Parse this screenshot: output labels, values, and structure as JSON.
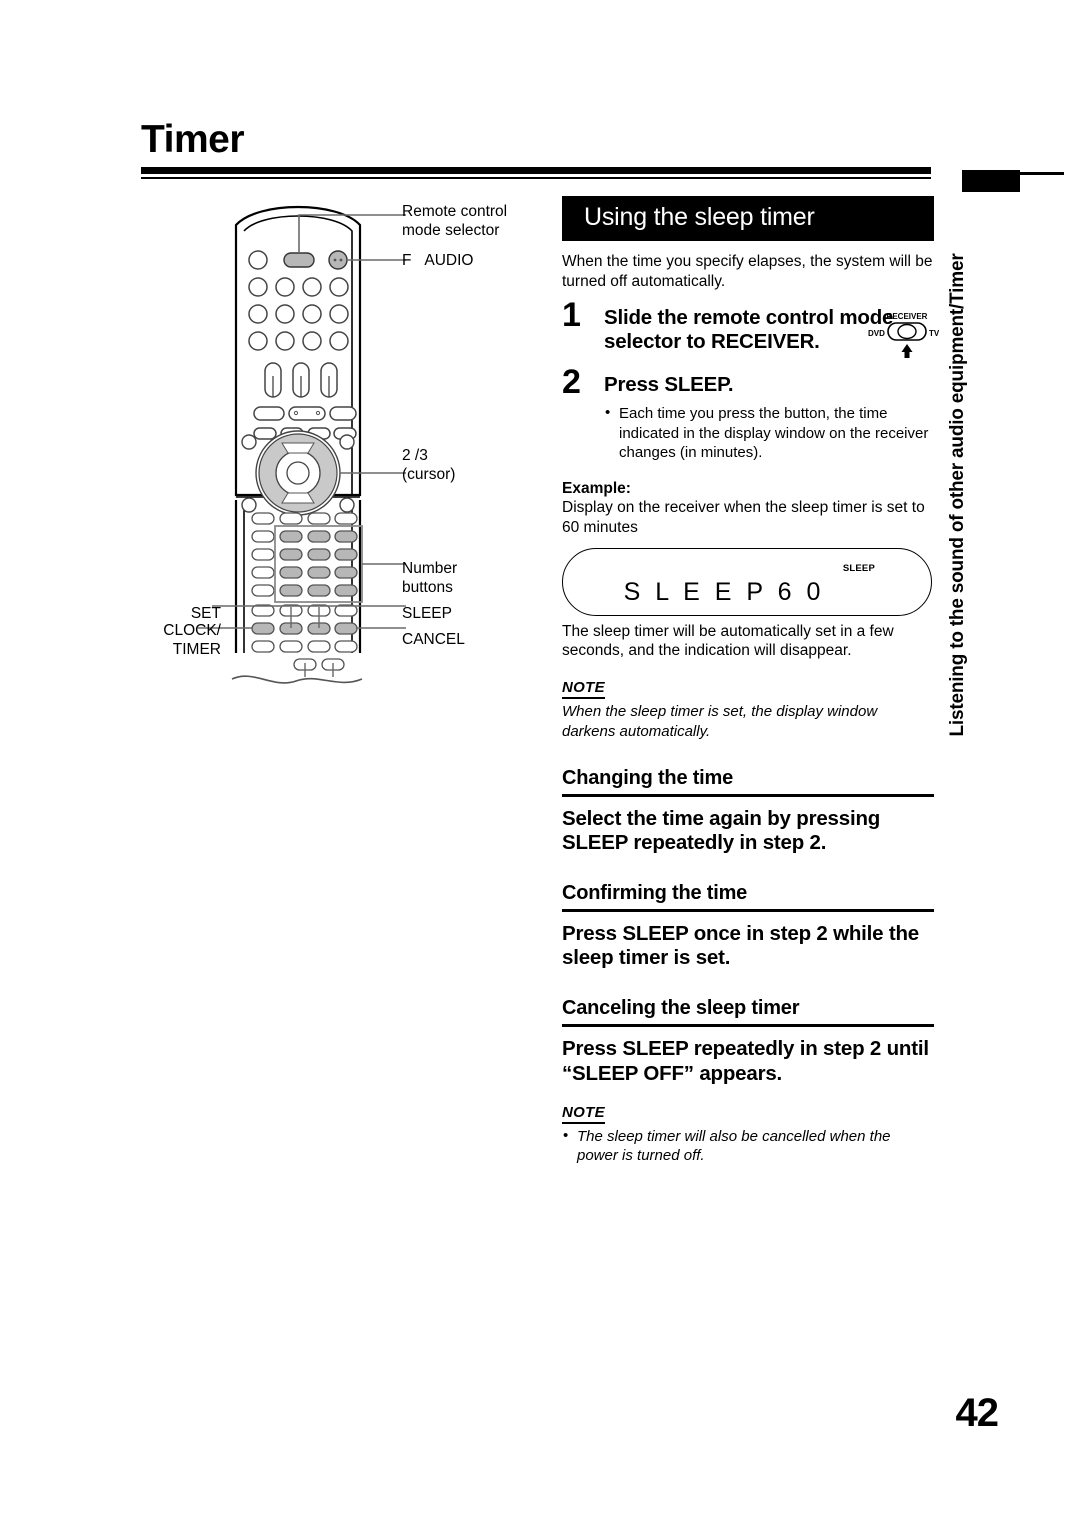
{
  "page": {
    "title": "Timer",
    "number": "42",
    "running_head_vertical": "Listening to the sound of other audio equipment/Timer"
  },
  "remote_diagram": {
    "callouts": {
      "mode_selector": "Remote control\nmode selector",
      "f_audio": "F   AUDIO",
      "cursor": "2 /3\n(cursor)",
      "number_buttons": "Number\nbuttons",
      "sleep": "SLEEP",
      "cancel": "CANCEL",
      "set": "SET",
      "clock_timer": "CLOCK/\nTIMER"
    }
  },
  "section": {
    "banner_title": "Using the sleep timer",
    "intro": "When the time you specify elapses, the system will be turned off automatically."
  },
  "steps": [
    {
      "number": "1",
      "heading": "Slide the remote control mode selector to RECEIVER.",
      "bullets": []
    },
    {
      "number": "2",
      "heading": "Press SLEEP.",
      "bullets": [
        "Each time you press the button, the time indicated in the display window on the receiver changes (in minutes)."
      ]
    }
  ],
  "mode_selector_diagram": {
    "top_label": "RECEIVER",
    "left_label": "DVD",
    "right_label": "TV"
  },
  "example": {
    "label": "Example:",
    "body": "Display on the receiver when the sleep timer is set to 60 minutes",
    "display_window": {
      "indicator": "SLEEP",
      "main_text": "S L E E P    6 0"
    },
    "after_text": "The sleep timer will be automatically set in a few seconds, and the indication will disappear."
  },
  "notes": [
    {
      "title": "NOTE",
      "body": "When the sleep timer is set, the display window darkens automatically.",
      "bulleted": false
    },
    {
      "title": "NOTE",
      "body": "The sleep timer will also be cancelled when the power is turned off.",
      "bulleted": true
    }
  ],
  "subsections": [
    {
      "title": "Changing the time",
      "body": "Select the time again by pressing SLEEP repeatedly in step 2."
    },
    {
      "title": "Confirming the time",
      "body": "Press SLEEP once in step 2 while the sleep timer is set."
    },
    {
      "title": "Canceling the sleep timer",
      "body": "Press SLEEP repeatedly in step 2 until “SLEEP OFF” appears."
    }
  ]
}
